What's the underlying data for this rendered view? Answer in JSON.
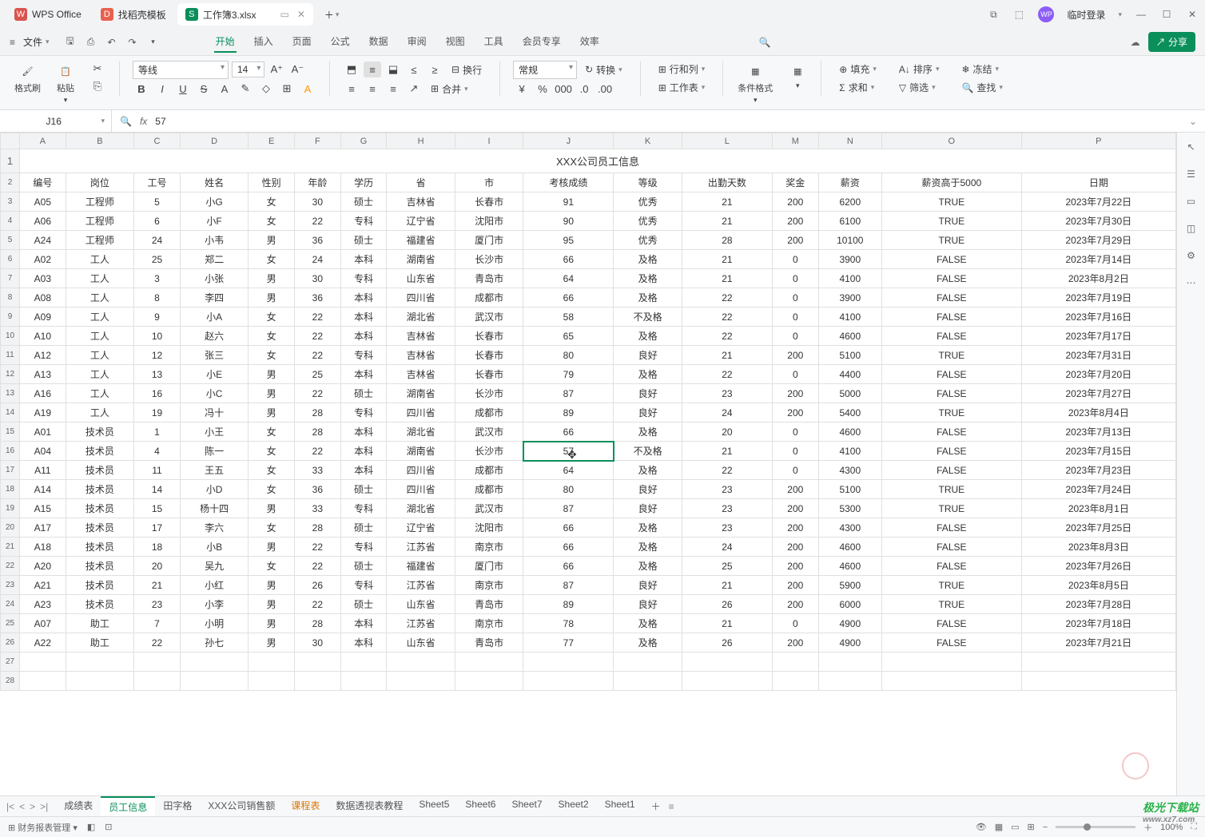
{
  "titlebar": {
    "app_name": "WPS Office",
    "find_template": "找稻壳模板",
    "doc_tab": "工作簿3.xlsx",
    "login": "临时登录"
  },
  "menubar": {
    "file": "文件",
    "tabs": [
      "开始",
      "插入",
      "页面",
      "公式",
      "数据",
      "审阅",
      "视图",
      "工具",
      "会员专享",
      "效率"
    ],
    "share": "分享"
  },
  "ribbon": {
    "format_brush": "格式刷",
    "paste": "粘贴",
    "font_name": "等线",
    "font_size": "14",
    "wrap": "换行",
    "merge": "合并",
    "number_format": "常规",
    "convert": "转换",
    "rowcol": "行和列",
    "worksheet": "工作表",
    "cond_format": "条件格式",
    "fill": "填充",
    "sum": "求和",
    "sort": "排序",
    "filter": "筛选",
    "freeze": "冻结",
    "find": "查找"
  },
  "namebox": {
    "ref": "J16",
    "formula": "57"
  },
  "table": {
    "title": "XXX公司员工信息",
    "cols": [
      "A",
      "B",
      "C",
      "D",
      "E",
      "F",
      "G",
      "H",
      "I",
      "J",
      "K",
      "L",
      "M",
      "N",
      "O",
      "P"
    ],
    "headers": [
      "编号",
      "岗位",
      "工号",
      "姓名",
      "性别",
      "年龄",
      "学历",
      "省",
      "市",
      "考核成绩",
      "等级",
      "出勤天数",
      "奖金",
      "薪资",
      "薪资高于5000",
      "日期"
    ],
    "rows": [
      [
        "A05",
        "工程师",
        "5",
        "小G",
        "女",
        "30",
        "硕士",
        "吉林省",
        "长春市",
        "91",
        "优秀",
        "21",
        "200",
        "6200",
        "TRUE",
        "2023年7月22日"
      ],
      [
        "A06",
        "工程师",
        "6",
        "小F",
        "女",
        "22",
        "专科",
        "辽宁省",
        "沈阳市",
        "90",
        "优秀",
        "21",
        "200",
        "6100",
        "TRUE",
        "2023年7月30日"
      ],
      [
        "A24",
        "工程师",
        "24",
        "小韦",
        "男",
        "36",
        "硕士",
        "福建省",
        "厦门市",
        "95",
        "优秀",
        "28",
        "200",
        "10100",
        "TRUE",
        "2023年7月29日"
      ],
      [
        "A02",
        "工人",
        "25",
        "郑二",
        "女",
        "24",
        "本科",
        "湖南省",
        "长沙市",
        "66",
        "及格",
        "21",
        "0",
        "3900",
        "FALSE",
        "2023年7月14日"
      ],
      [
        "A03",
        "工人",
        "3",
        "小张",
        "男",
        "30",
        "专科",
        "山东省",
        "青岛市",
        "64",
        "及格",
        "21",
        "0",
        "4100",
        "FALSE",
        "2023年8月2日"
      ],
      [
        "A08",
        "工人",
        "8",
        "李四",
        "男",
        "36",
        "本科",
        "四川省",
        "成都市",
        "66",
        "及格",
        "22",
        "0",
        "3900",
        "FALSE",
        "2023年7月19日"
      ],
      [
        "A09",
        "工人",
        "9",
        "小A",
        "女",
        "22",
        "本科",
        "湖北省",
        "武汉市",
        "58",
        "不及格",
        "22",
        "0",
        "4100",
        "FALSE",
        "2023年7月16日"
      ],
      [
        "A10",
        "工人",
        "10",
        "赵六",
        "女",
        "22",
        "本科",
        "吉林省",
        "长春市",
        "65",
        "及格",
        "22",
        "0",
        "4600",
        "FALSE",
        "2023年7月17日"
      ],
      [
        "A12",
        "工人",
        "12",
        "张三",
        "女",
        "22",
        "专科",
        "吉林省",
        "长春市",
        "80",
        "良好",
        "21",
        "200",
        "5100",
        "TRUE",
        "2023年7月31日"
      ],
      [
        "A13",
        "工人",
        "13",
        "小E",
        "男",
        "25",
        "本科",
        "吉林省",
        "长春市",
        "79",
        "及格",
        "22",
        "0",
        "4400",
        "FALSE",
        "2023年7月20日"
      ],
      [
        "A16",
        "工人",
        "16",
        "小C",
        "男",
        "22",
        "硕士",
        "湖南省",
        "长沙市",
        "87",
        "良好",
        "23",
        "200",
        "5000",
        "FALSE",
        "2023年7月27日"
      ],
      [
        "A19",
        "工人",
        "19",
        "冯十",
        "男",
        "28",
        "专科",
        "四川省",
        "成都市",
        "89",
        "良好",
        "24",
        "200",
        "5400",
        "TRUE",
        "2023年8月4日"
      ],
      [
        "A01",
        "技术员",
        "1",
        "小王",
        "女",
        "28",
        "本科",
        "湖北省",
        "武汉市",
        "66",
        "及格",
        "20",
        "0",
        "4600",
        "FALSE",
        "2023年7月13日"
      ],
      [
        "A04",
        "技术员",
        "4",
        "陈一",
        "女",
        "22",
        "本科",
        "湖南省",
        "长沙市",
        "57",
        "不及格",
        "21",
        "0",
        "4100",
        "FALSE",
        "2023年7月15日"
      ],
      [
        "A11",
        "技术员",
        "11",
        "王五",
        "女",
        "33",
        "本科",
        "四川省",
        "成都市",
        "64",
        "及格",
        "22",
        "0",
        "4300",
        "FALSE",
        "2023年7月23日"
      ],
      [
        "A14",
        "技术员",
        "14",
        "小D",
        "女",
        "36",
        "硕士",
        "四川省",
        "成都市",
        "80",
        "良好",
        "23",
        "200",
        "5100",
        "TRUE",
        "2023年7月24日"
      ],
      [
        "A15",
        "技术员",
        "15",
        "杨十四",
        "男",
        "33",
        "专科",
        "湖北省",
        "武汉市",
        "87",
        "良好",
        "23",
        "200",
        "5300",
        "TRUE",
        "2023年8月1日"
      ],
      [
        "A17",
        "技术员",
        "17",
        "李六",
        "女",
        "28",
        "硕士",
        "辽宁省",
        "沈阳市",
        "66",
        "及格",
        "23",
        "200",
        "4300",
        "FALSE",
        "2023年7月25日"
      ],
      [
        "A18",
        "技术员",
        "18",
        "小B",
        "男",
        "22",
        "专科",
        "江苏省",
        "南京市",
        "66",
        "及格",
        "24",
        "200",
        "4600",
        "FALSE",
        "2023年8月3日"
      ],
      [
        "A20",
        "技术员",
        "20",
        "吴九",
        "女",
        "22",
        "硕士",
        "福建省",
        "厦门市",
        "66",
        "及格",
        "25",
        "200",
        "4600",
        "FALSE",
        "2023年7月26日"
      ],
      [
        "A21",
        "技术员",
        "21",
        "小红",
        "男",
        "26",
        "专科",
        "江苏省",
        "南京市",
        "87",
        "良好",
        "21",
        "200",
        "5900",
        "TRUE",
        "2023年8月5日"
      ],
      [
        "A23",
        "技术员",
        "23",
        "小李",
        "男",
        "22",
        "硕士",
        "山东省",
        "青岛市",
        "89",
        "良好",
        "26",
        "200",
        "6000",
        "TRUE",
        "2023年7月28日"
      ],
      [
        "A07",
        "助工",
        "7",
        "小明",
        "男",
        "28",
        "本科",
        "江苏省",
        "南京市",
        "78",
        "及格",
        "21",
        "0",
        "4900",
        "FALSE",
        "2023年7月18日"
      ],
      [
        "A22",
        "助工",
        "22",
        "孙七",
        "男",
        "30",
        "本科",
        "山东省",
        "青岛市",
        "77",
        "及格",
        "26",
        "200",
        "4900",
        "FALSE",
        "2023年7月21日"
      ]
    ],
    "selected_cell": {
      "row": 16,
      "col": "J"
    }
  },
  "sheets": [
    "成绩表",
    "员工信息",
    "田字格",
    "XXX公司销售额",
    "课程表",
    "数据透视表教程",
    "Sheet5",
    "Sheet6",
    "Sheet7",
    "Sheet2",
    "Sheet1"
  ],
  "sheets_active": "员工信息",
  "sheets_orange": "课程表",
  "statusbar": {
    "mgr": "财务报表管理",
    "zoom": "100%"
  },
  "watermark": {
    "brand": "极光下载站",
    "url": "www.xz7.com"
  }
}
